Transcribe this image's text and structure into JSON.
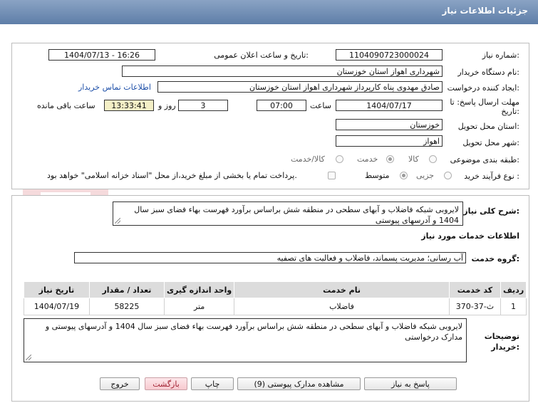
{
  "page_title": "جزئیات اطلاعات نیاز",
  "watermark_text": "AriaTender.net",
  "fields": {
    "need_number_label": "شماره نیاز:",
    "need_number": "1104090723000024",
    "announce_label": "تاریخ و ساعت اعلان عمومی:",
    "announce_value": "1404/07/13 - 16:26",
    "buyer_label": "نام دستگاه خریدار:",
    "buyer_value": "شهرداری اهواز استان خوزستان",
    "requester_label": "ایجاد کننده درخواست:",
    "requester_value": "صادق مهدوی پناه کارپرداز شهرداری اهواز استان خوزستان",
    "contact_link": "اطلاعات تماس خریدار",
    "deadline_label_line1": "مهلت ارسال پاسخ: تا",
    "deadline_label_line2": "تاریخ:",
    "deadline_date": "1404/07/17",
    "time_label": "ساعت",
    "deadline_time": "07:00",
    "days_value": "3",
    "days_label": "روز و",
    "remaining_time": "13:33:41",
    "remaining_label": "ساعت باقی مانده",
    "province_label": "استان محل تحویل:",
    "province_value": "خوزستان",
    "city_label": "شهر محل تحویل:",
    "city_value": "اهواز",
    "category_label": "طبقه بندی موضوعی:",
    "category_options": [
      "کالا",
      "خدمت",
      "کالا/خدمت"
    ],
    "category_selected": "خدمت",
    "process_label": "نوع فرآیند خرید :",
    "process_options": [
      "جزیی",
      "متوسط"
    ],
    "process_selected": "متوسط",
    "payment_note": "پرداخت تمام یا بخشی از مبلغ خرید،از محل \"اسناد خزانه اسلامی\" خواهد بود."
  },
  "summary": {
    "label": "شرح کلی نیاز:",
    "text": "لایروبی شبکه فاضلاب و آبهای سطحی در منطقه شش براساس برآورد فهرست بهاء فضای سبز سال 1404 و آدرسهای پیوستی"
  },
  "services_section": {
    "heading": "اطلاعات خدمات مورد نیاز",
    "group_label": "گروه خدمت:",
    "group_value": "آب رسانی؛ مدیریت پسماند، فاضلاب و فعالیت های تصفیه"
  },
  "table": {
    "headers": [
      "ردیف",
      "کد خدمت",
      "نام خدمت",
      "واحد اندازه گیری",
      "تعداد / مقدار",
      "تاریخ نیاز"
    ],
    "rows": [
      [
        "1",
        "ث-37-370",
        "فاضلاب",
        "متر",
        "58225",
        "1404/07/19"
      ]
    ]
  },
  "buyer_notes": {
    "label_line1": "توضیحات",
    "label_line2": "خریدار:",
    "text": "لایروبی شبکه فاضلاب و آبهای سطحی در منطقه شش براساس برآورد فهرست بهاء فضای سبز سال 1404 و آدرسهای پیوستی و مدارک درخواستی"
  },
  "buttons": {
    "reply": "پاسخ به نیاز",
    "attachments": "مشاهده مدارک پیوستی (9)",
    "print": "چاپ",
    "back": "بازگشت",
    "exit": "خروج"
  },
  "colors": {
    "title_bar": "#6f8db5",
    "highlight": "#f4efc6",
    "link": "#1d4fa8",
    "red_button": "#f7c9cf"
  }
}
